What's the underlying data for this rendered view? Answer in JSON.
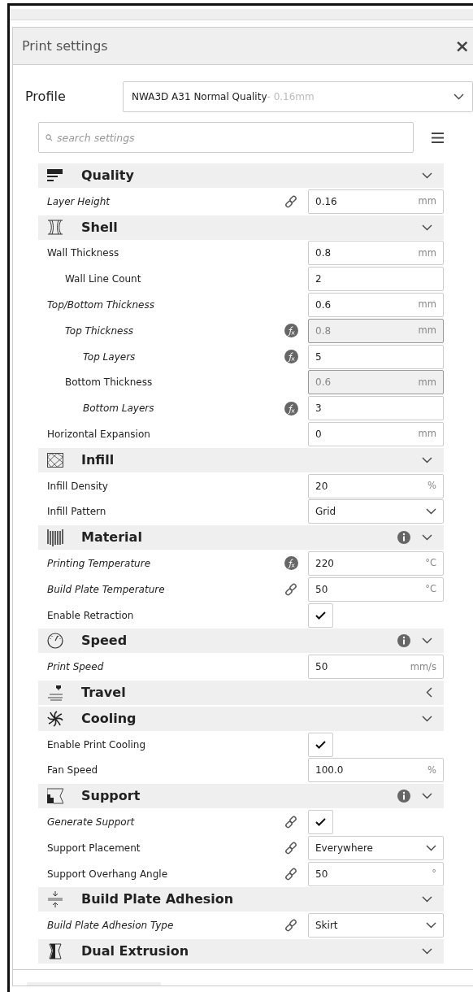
{
  "panel": {
    "title": "Print settings",
    "close": "×"
  },
  "profile": {
    "label": "Profile",
    "name": "NWA3D A31 Normal Quality",
    "suffix": " - 0.16mm"
  },
  "search": {
    "placeholder": "search settings"
  },
  "sections": [
    {
      "title": "Quality",
      "expanded": true,
      "info": false,
      "settings": [
        {
          "label": "Layer Height",
          "modified": true,
          "linked": true,
          "kind": "number",
          "value": "0.16",
          "unit": "mm"
        }
      ]
    },
    {
      "title": "Shell",
      "expanded": true,
      "info": false,
      "settings": [
        {
          "label": "Wall Thickness",
          "modified": false,
          "kind": "number",
          "value": "0.8",
          "unit": "mm",
          "children": [
            {
              "label": "Wall Line Count",
              "modified": false,
              "kind": "number",
              "value": "2"
            }
          ]
        },
        {
          "label": "Top/Bottom Thickness",
          "modified": true,
          "kind": "number",
          "value": "0.6",
          "unit": "mm",
          "children": [
            {
              "label": "Top Thickness",
              "modified": true,
              "formula": true,
              "kind": "number",
              "value": "0.8",
              "unit": "mm",
              "disabled": true,
              "children": [
                {
                  "label": "Top Layers",
                  "modified": true,
                  "formula": true,
                  "kind": "number",
                  "value": "5"
                }
              ]
            },
            {
              "label": "Bottom Thickness",
              "modified": false,
              "kind": "number",
              "value": "0.6",
              "unit": "mm",
              "disabled": true,
              "children": [
                {
                  "label": "Bottom Layers",
                  "modified": true,
                  "formula": true,
                  "kind": "number",
                  "value": "3"
                }
              ]
            }
          ]
        },
        {
          "label": "Horizontal Expansion",
          "modified": false,
          "kind": "number",
          "value": "0",
          "unit": "mm"
        }
      ]
    },
    {
      "title": "Infill",
      "expanded": true,
      "info": false,
      "settings": [
        {
          "label": "Infill Density",
          "modified": false,
          "kind": "number",
          "value": "20",
          "unit": "%"
        },
        {
          "label": "Infill Pattern",
          "modified": false,
          "kind": "select",
          "value": "Grid"
        }
      ]
    },
    {
      "title": "Material",
      "expanded": true,
      "info": true,
      "settings": [
        {
          "label": "Printing Temperature",
          "modified": true,
          "formula": true,
          "kind": "number",
          "value": "220",
          "unit": "°C"
        },
        {
          "label": "Build Plate Temperature",
          "modified": true,
          "linked": true,
          "kind": "number",
          "value": "50",
          "unit": "°C"
        },
        {
          "label": "Enable Retraction",
          "modified": false,
          "kind": "checkbox",
          "checked": true
        }
      ]
    },
    {
      "title": "Speed",
      "expanded": true,
      "info": true,
      "settings": [
        {
          "label": "Print Speed",
          "modified": true,
          "kind": "number",
          "value": "50",
          "unit": "mm/s"
        }
      ]
    },
    {
      "title": "Travel",
      "expanded": false,
      "info": false
    },
    {
      "title": "Cooling",
      "expanded": true,
      "info": false,
      "settings": [
        {
          "label": "Enable Print Cooling",
          "modified": false,
          "kind": "checkbox",
          "checked": true
        },
        {
          "label": "Fan Speed",
          "modified": false,
          "kind": "number",
          "value": "100.0",
          "unit": "%"
        }
      ]
    },
    {
      "title": "Support",
      "expanded": true,
      "info": true,
      "settings": [
        {
          "label": "Generate Support",
          "modified": true,
          "linked": true,
          "kind": "checkbox",
          "checked": true
        },
        {
          "label": "Support Placement",
          "modified": false,
          "linked": true,
          "kind": "select",
          "value": "Everywhere"
        },
        {
          "label": "Support Overhang Angle",
          "modified": false,
          "linked": true,
          "kind": "number",
          "value": "50",
          "unit": "°"
        }
      ]
    },
    {
      "title": "Build Plate Adhesion",
      "expanded": true,
      "info": false,
      "settings": [
        {
          "label": "Build Plate Adhesion Type",
          "modified": true,
          "linked": true,
          "kind": "select",
          "value": "Skirt"
        }
      ]
    },
    {
      "title": "Dual Extrusion",
      "expanded": true,
      "info": false
    }
  ]
}
